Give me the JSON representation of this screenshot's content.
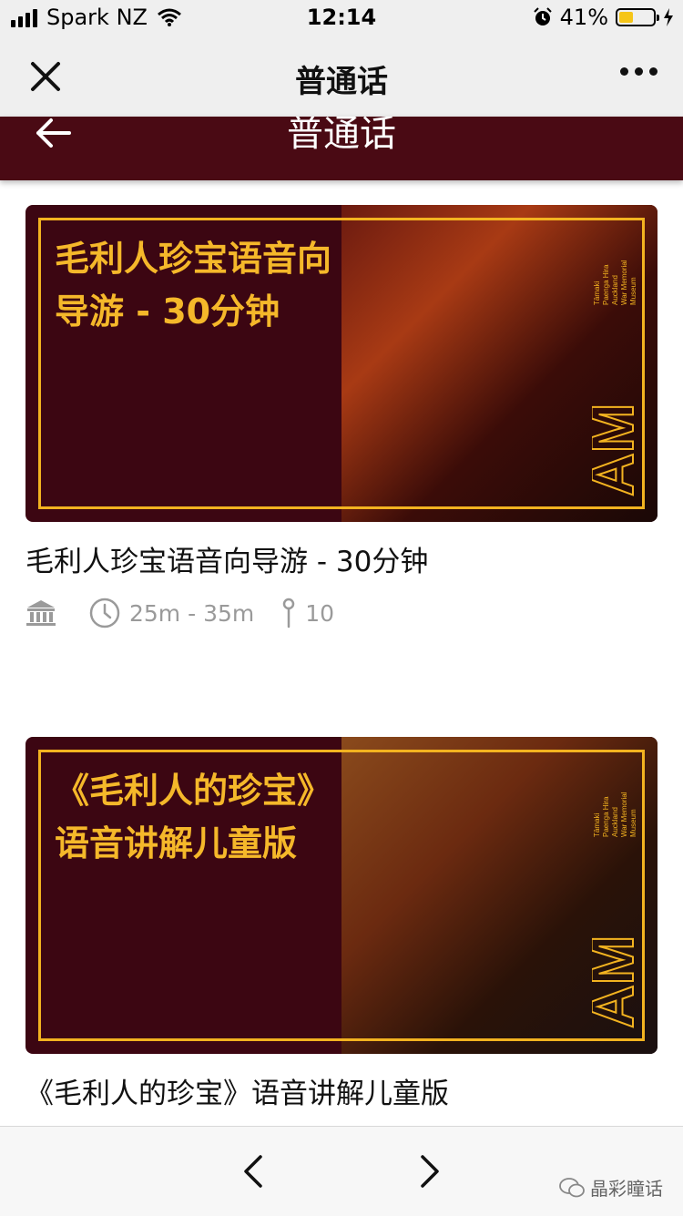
{
  "status": {
    "carrier": "Spark NZ",
    "time": "12:14",
    "battery_pct": "41%",
    "battery_level": 0.41
  },
  "wechat": {
    "title": "普通话"
  },
  "page": {
    "title": "普通话"
  },
  "cards": [
    {
      "banner_title": "毛利人珍宝语音向导游 - 30分钟",
      "name": "毛利人珍宝语音向导游 - 30分钟",
      "duration": "25m - 35m",
      "stops": "10"
    },
    {
      "banner_title": "《毛利人的珍宝》语音讲解儿童版",
      "name": "《毛利人的珍宝》语音讲解儿童版"
    }
  ],
  "museum_mark": {
    "logo": "AM",
    "lines": [
      "Tāmaki",
      "Paenga Hira",
      "Auckland",
      "War Memorial",
      "Museum"
    ]
  },
  "footer": {
    "watermark": "晶彩瞳话"
  },
  "colors": {
    "maroon": "#4a0a14",
    "gold": "#f3b320"
  }
}
